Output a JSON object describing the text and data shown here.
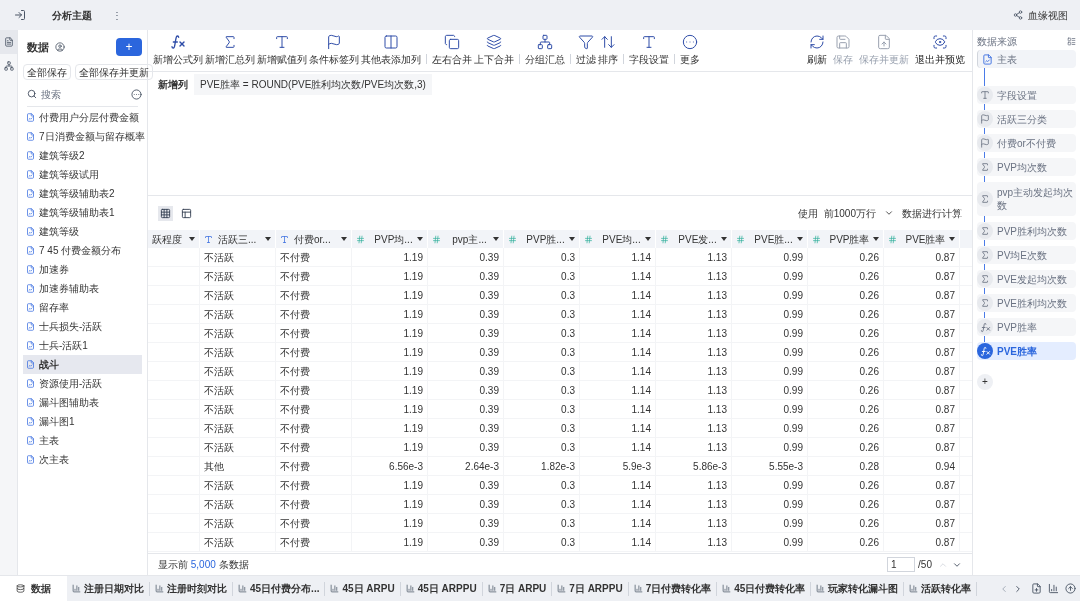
{
  "topbar": {
    "title": "分析主题",
    "menu": "⋮",
    "lineage": "血缘视图"
  },
  "sidebar": {
    "title": "数据",
    "add": "+",
    "buttons": [
      "全部保存",
      "全部保存并更新"
    ],
    "search": {
      "placeholder": "搜索"
    },
    "items": [
      {
        "label": "付费用户分层付费金额",
        "selected": false
      },
      {
        "label": "7日消费金额与留存概率",
        "selected": false
      },
      {
        "label": "建筑等级2",
        "selected": false
      },
      {
        "label": "建筑等级试用",
        "selected": false
      },
      {
        "label": "建筑等级辅助表2",
        "selected": false
      },
      {
        "label": "建筑等级辅助表1",
        "selected": false
      },
      {
        "label": "建筑等级",
        "selected": false
      },
      {
        "label": "7 45 付费金额分布",
        "selected": false
      },
      {
        "label": "加速券",
        "selected": false
      },
      {
        "label": "加速券辅助表",
        "selected": false
      },
      {
        "label": "留存率",
        "selected": false
      },
      {
        "label": "士兵损失-活跃",
        "selected": false
      },
      {
        "label": "士兵-活跃1",
        "selected": false
      },
      {
        "label": "战斗",
        "selected": true
      },
      {
        "label": "资源使用-活跃",
        "selected": false
      },
      {
        "label": "漏斗图辅助表",
        "selected": false
      },
      {
        "label": "漏斗图1",
        "selected": false
      },
      {
        "label": "主表",
        "selected": false
      },
      {
        "label": "次主表",
        "selected": false
      }
    ]
  },
  "toolbar": {
    "groups": [
      [
        {
          "kind": "formula",
          "label": "新增公式列"
        },
        {
          "kind": "sum",
          "label": "新增汇总列"
        },
        {
          "kind": "assign",
          "label": "新增赋值列"
        },
        {
          "kind": "tag",
          "label": "条件标签列"
        },
        {
          "kind": "addcol",
          "label": "其他表添加列"
        }
      ],
      [
        {
          "kind": "join",
          "label": "左右合并"
        },
        {
          "kind": "union",
          "label": "上下合并"
        }
      ],
      [
        {
          "kind": "group",
          "label": "分组汇总"
        }
      ],
      [
        {
          "kind": "filter",
          "label": "过滤"
        },
        {
          "kind": "sort",
          "label": "排序"
        }
      ],
      [
        {
          "kind": "field",
          "label": "字段设置"
        }
      ],
      [
        {
          "kind": "more",
          "label": "更多"
        }
      ]
    ],
    "right": [
      {
        "kind": "refresh",
        "label": "刷新",
        "disabled": false
      },
      {
        "kind": "save",
        "label": "保存",
        "disabled": true
      },
      {
        "kind": "saveupdate",
        "label": "保存并更新",
        "disabled": true
      },
      {
        "kind": "preview",
        "label": "退出并预览",
        "disabled": false
      }
    ]
  },
  "formula": {
    "label": "新增列",
    "value": "PVE胜率 = ROUND(PVE胜利均次数/PVE均次数,3)"
  },
  "table": {
    "use_label": "使用",
    "range": "前1000万行",
    "calc_label": "数据进行计算",
    "columns": [
      {
        "kind": "cut",
        "label": "跃程度"
      },
      {
        "kind": "text",
        "label": "活跃三..."
      },
      {
        "kind": "text",
        "label": "付费or..."
      },
      {
        "kind": "number",
        "label": "PVP均..."
      },
      {
        "kind": "number",
        "label": "pvp主..."
      },
      {
        "kind": "number",
        "label": "PVP胜..."
      },
      {
        "kind": "number",
        "label": "PVE均..."
      },
      {
        "kind": "number",
        "label": "PVE发..."
      },
      {
        "kind": "number",
        "label": "PVE胜..."
      },
      {
        "kind": "number",
        "label": "PVP胜率"
      },
      {
        "kind": "number",
        "label": "PVE胜率"
      }
    ],
    "rows": [
      [
        "不活跃",
        "不付费",
        "1.19",
        "0.39",
        "0.3",
        "1.14",
        "1.13",
        "0.99",
        "0.26",
        "0.87"
      ],
      [
        "不活跃",
        "不付费",
        "1.19",
        "0.39",
        "0.3",
        "1.14",
        "1.13",
        "0.99",
        "0.26",
        "0.87"
      ],
      [
        "不活跃",
        "不付费",
        "1.19",
        "0.39",
        "0.3",
        "1.14",
        "1.13",
        "0.99",
        "0.26",
        "0.87"
      ],
      [
        "不活跃",
        "不付费",
        "1.19",
        "0.39",
        "0.3",
        "1.14",
        "1.13",
        "0.99",
        "0.26",
        "0.87"
      ],
      [
        "不活跃",
        "不付费",
        "1.19",
        "0.39",
        "0.3",
        "1.14",
        "1.13",
        "0.99",
        "0.26",
        "0.87"
      ],
      [
        "不活跃",
        "不付费",
        "1.19",
        "0.39",
        "0.3",
        "1.14",
        "1.13",
        "0.99",
        "0.26",
        "0.87"
      ],
      [
        "不活跃",
        "不付费",
        "1.19",
        "0.39",
        "0.3",
        "1.14",
        "1.13",
        "0.99",
        "0.26",
        "0.87"
      ],
      [
        "不活跃",
        "不付费",
        "1.19",
        "0.39",
        "0.3",
        "1.14",
        "1.13",
        "0.99",
        "0.26",
        "0.87"
      ],
      [
        "不活跃",
        "不付费",
        "1.19",
        "0.39",
        "0.3",
        "1.14",
        "1.13",
        "0.99",
        "0.26",
        "0.87"
      ],
      [
        "不活跃",
        "不付费",
        "1.19",
        "0.39",
        "0.3",
        "1.14",
        "1.13",
        "0.99",
        "0.26",
        "0.87"
      ],
      [
        "不活跃",
        "不付费",
        "1.19",
        "0.39",
        "0.3",
        "1.14",
        "1.13",
        "0.99",
        "0.26",
        "0.87"
      ],
      [
        "其他",
        "不付费",
        "6.56e-3",
        "2.64e-3",
        "1.82e-3",
        "5.9e-3",
        "5.86e-3",
        "5.55e-3",
        "0.28",
        "0.94"
      ],
      [
        "不活跃",
        "不付费",
        "1.19",
        "0.39",
        "0.3",
        "1.14",
        "1.13",
        "0.99",
        "0.26",
        "0.87"
      ],
      [
        "不活跃",
        "不付费",
        "1.19",
        "0.39",
        "0.3",
        "1.14",
        "1.13",
        "0.99",
        "0.26",
        "0.87"
      ],
      [
        "不活跃",
        "不付费",
        "1.19",
        "0.39",
        "0.3",
        "1.14",
        "1.13",
        "0.99",
        "0.26",
        "0.87"
      ],
      [
        "不活跃",
        "不付费",
        "1.19",
        "0.39",
        "0.3",
        "1.14",
        "1.13",
        "0.99",
        "0.26",
        "0.87"
      ]
    ],
    "footer": {
      "prefix": "显示前",
      "count": "5,000",
      "suffix": "条数据",
      "page": "1",
      "pages": "/50"
    }
  },
  "flow": {
    "title": "数据来源",
    "add": "+",
    "steps": [
      {
        "kind": "source",
        "label": "主表",
        "selected": false
      },
      {
        "kind": "field",
        "label": "字段设置",
        "selected": false
      },
      {
        "kind": "tag",
        "label": "活跃三分类",
        "selected": false
      },
      {
        "kind": "tag",
        "label": "付费or不付费",
        "selected": false
      },
      {
        "kind": "sum",
        "label": "PVP均次数",
        "selected": false
      },
      {
        "kind": "sum",
        "label": "pvp主动发起均次数",
        "selected": false
      },
      {
        "kind": "sum",
        "label": "PVP胜利均次数",
        "selected": false
      },
      {
        "kind": "sum",
        "label": "PV均E次数",
        "selected": false
      },
      {
        "kind": "sum",
        "label": "PVE发起均次数",
        "selected": false
      },
      {
        "kind": "sum",
        "label": "PVE胜利均次数",
        "selected": false
      },
      {
        "kind": "formula",
        "label": "PVP胜率",
        "selected": false
      },
      {
        "kind": "formula",
        "label": "PVE胜率",
        "selected": true
      }
    ]
  },
  "bottom_tabs": [
    {
      "kind": "data",
      "label": "数据",
      "selected": true
    },
    {
      "kind": "chart",
      "label": "注册日期对比",
      "selected": false
    },
    {
      "kind": "chart",
      "label": "注册时刻对比",
      "selected": false
    },
    {
      "kind": "chart",
      "label": "45日付费分布...",
      "selected": false
    },
    {
      "kind": "chart",
      "label": "45日 ARPU",
      "selected": false
    },
    {
      "kind": "chart",
      "label": "45日 ARPPU",
      "selected": false
    },
    {
      "kind": "chart",
      "label": "7日 ARPU",
      "selected": false
    },
    {
      "kind": "chart",
      "label": "7日 ARPPU",
      "selected": false
    },
    {
      "kind": "chart",
      "label": "7日付费转化率",
      "selected": false
    },
    {
      "kind": "chart",
      "label": "45日付费转化率",
      "selected": false
    },
    {
      "kind": "chart",
      "label": "玩家转化漏斗图",
      "selected": false
    },
    {
      "kind": "chart",
      "label": "活跃转化率",
      "selected": false
    }
  ]
}
